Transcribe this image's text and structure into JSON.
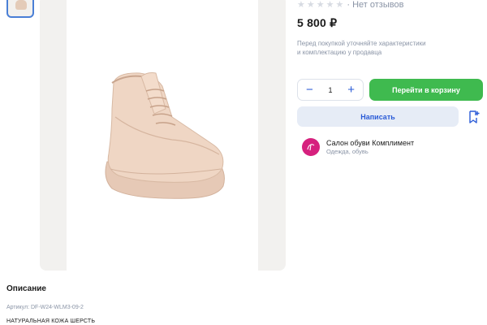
{
  "gallery": {
    "thumbnail_icon": "boot-thumbnail",
    "main_image_icon": "boot-photo"
  },
  "product": {
    "reviews_text": "· Нет отзывов",
    "rating_stars": 0,
    "rating_max": 5,
    "price": "5 800 ₽",
    "note_line1": "Перед покупкой уточняйте характеристики",
    "note_line2": "и комплектацию у продавца"
  },
  "cart": {
    "minus_label": "−",
    "quantity": "1",
    "plus_label": "+",
    "cart_button": "Перейти в корзину",
    "write_button": "Написать",
    "favorite_icon": "bookmark-add-icon"
  },
  "seller": {
    "name": "Салон обуви Комплимент",
    "category": "Одежда, обувь",
    "avatar_color": "#d6217e"
  },
  "description": {
    "title": "Описание",
    "sku": "Артикул: DF-W24-WLM3-09-2",
    "material": "НАТУРАЛЬНАЯ КОЖА ШЕРСТЬ"
  },
  "colors": {
    "accent": "#2a5bd7",
    "cart": "#3fba4f",
    "muted": "#8a94a6"
  }
}
